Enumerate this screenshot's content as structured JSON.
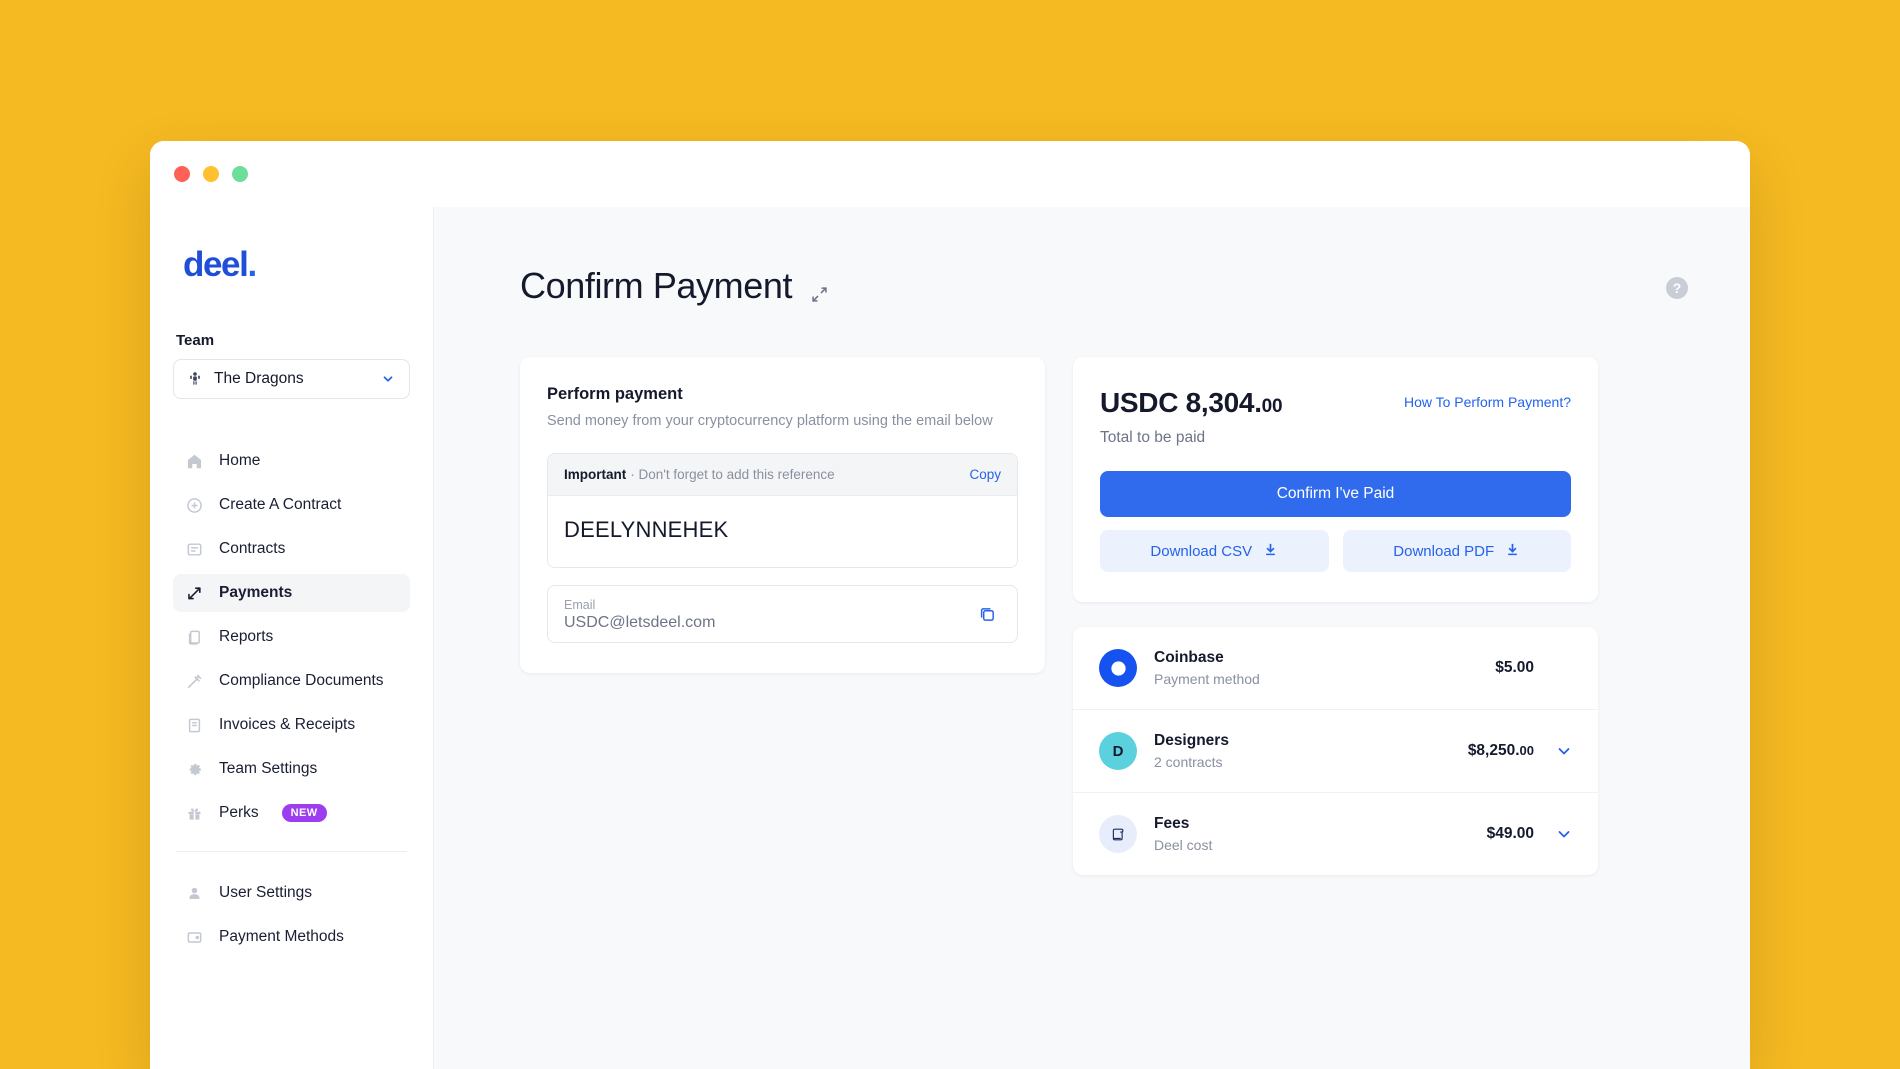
{
  "window": {
    "traffic_lights": [
      "close",
      "minimize",
      "maximize"
    ]
  },
  "sidebar": {
    "logo": "deel",
    "logo_dot": ".",
    "team_label": "Team",
    "team_selected": "The Dragons",
    "nav_primary": [
      {
        "label": "Home",
        "icon": "home-icon",
        "active": false
      },
      {
        "label": "Create A Contract",
        "icon": "plus-circle-icon",
        "active": false
      },
      {
        "label": "Contracts",
        "icon": "contract-icon",
        "active": false
      },
      {
        "label": "Payments",
        "icon": "transfer-arrows-icon",
        "active": true
      },
      {
        "label": "Reports",
        "icon": "reports-icon",
        "active": false
      },
      {
        "label": "Compliance Documents",
        "icon": "compliance-icon",
        "active": false
      },
      {
        "label": "Invoices & Receipts",
        "icon": "invoice-icon",
        "active": false
      },
      {
        "label": "Team Settings",
        "icon": "gear-icon",
        "active": false
      },
      {
        "label": "Perks",
        "icon": "gift-icon",
        "active": false,
        "badge": "NEW"
      }
    ],
    "nav_secondary": [
      {
        "label": "User Settings",
        "icon": "user-icon"
      },
      {
        "label": "Payment Methods",
        "icon": "card-icon"
      }
    ]
  },
  "header": {
    "title": "Confirm Payment",
    "expand_icon": "expand-arrows-icon",
    "help_icon": "question-mark-icon",
    "help_label": "?"
  },
  "perform_payment": {
    "title": "Perform payment",
    "subtitle": "Send money from your cryptocurrency platform using the email below",
    "reference": {
      "important_label": "Important",
      "important_text": "· Don't forget to add this reference",
      "copy_label": "Copy",
      "value": "DEELYNNEHEK"
    },
    "email": {
      "label": "Email",
      "value": "USDC@letsdeel.com",
      "copy_icon": "copy-icon"
    }
  },
  "summary": {
    "currency": "USDC",
    "amount_whole": " 8,304.",
    "amount_cents": "00",
    "total_label": "Total to be paid",
    "how_link": "How To Perform Payment?",
    "confirm_button": "Confirm I've Paid",
    "download_csv": "Download CSV",
    "download_pdf": "Download PDF",
    "download_icon": "download-icon"
  },
  "breakdown": [
    {
      "name": "Coinbase",
      "sub": "Payment method",
      "amount": "$5.00",
      "amount_cents": "",
      "avatar_letter": "C",
      "avatar_bg": "#1652F0",
      "avatar_fg": "#ffffff",
      "avatar_type": "coinbase-logo",
      "expandable": false
    },
    {
      "name": "Designers",
      "sub": "2 contracts",
      "amount": "$8,250.",
      "amount_cents": "00",
      "avatar_letter": "D",
      "avatar_bg": "#5CD1DE",
      "avatar_fg": "#15192C",
      "avatar_type": "letter",
      "expandable": true
    },
    {
      "name": "Fees",
      "sub": "Deel cost",
      "amount": "$49.00",
      "amount_cents": "",
      "avatar_letter": "",
      "avatar_bg": "#E7EDFB",
      "avatar_fg": "#1F2B5B",
      "avatar_type": "scroll-icon",
      "expandable": true
    }
  ],
  "colors": {
    "page_background": "#F5B921",
    "brand_blue": "#2563EB",
    "primary_button": "#2F6BEC",
    "badge_purple": "#9C3EF0"
  }
}
